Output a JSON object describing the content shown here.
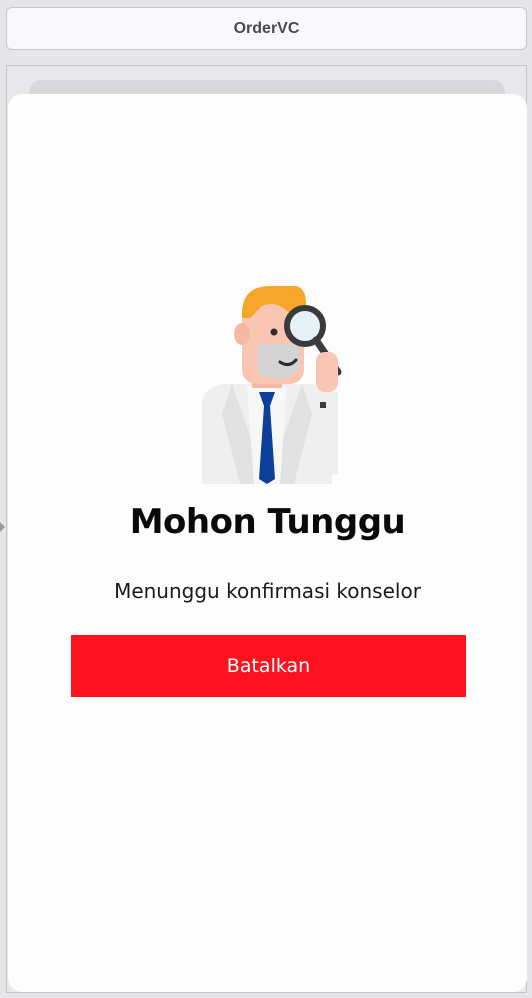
{
  "window": {
    "title": "OrderVC"
  },
  "dialog": {
    "title": "Mohon Tunggu",
    "message": "Menunggu konfirmasi konselor",
    "cancel_label": "Batalkan",
    "illustration_icon": "counselor-with-magnifier-icon"
  },
  "colors": {
    "accent": "#ff121d",
    "tie": "#0b3f9a",
    "hair": "#f6a62a",
    "skin": "#f9c6b4"
  }
}
